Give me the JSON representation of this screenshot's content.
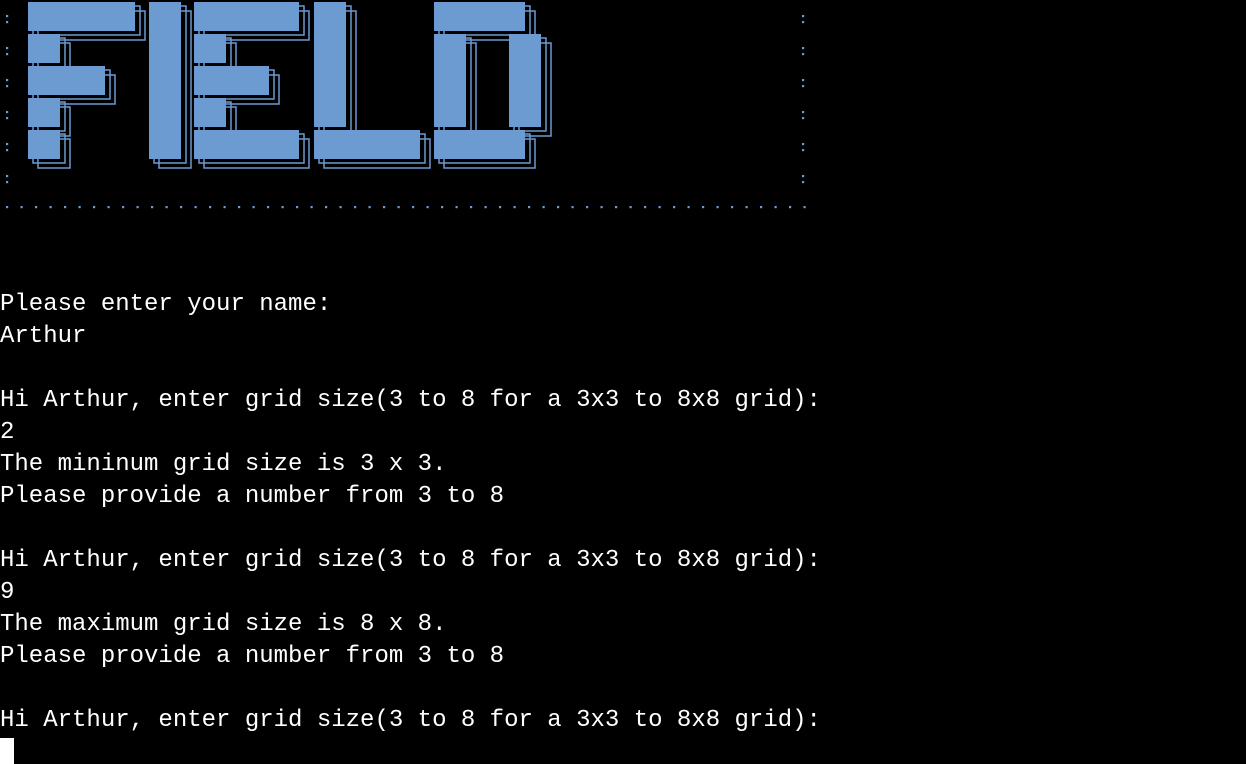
{
  "banner": {
    "word": "FIELD",
    "fill_color": "#6c9bd2",
    "outline_color": "#6c9bd2",
    "dot_color": "#6c9bd2"
  },
  "terminal": {
    "lines": [
      "Please enter your name:",
      "Arthur",
      "",
      "Hi Arthur, enter grid size(3 to 8 for a 3x3 to 8x8 grid):",
      "2",
      "The mininum grid size is 3 x 3.",
      "Please provide a number from 3 to 8",
      "",
      "Hi Arthur, enter grid size(3 to 8 for a 3x3 to 8x8 grid):",
      "9",
      "The maximum grid size is 8 x 8.",
      "Please provide a number from 3 to 8",
      "",
      "Hi Arthur, enter grid size(3 to 8 for a 3x3 to 8x8 grid):"
    ]
  },
  "colors": {
    "background": "#000000",
    "text": "#ffffff",
    "accent": "#6c9bd2"
  }
}
